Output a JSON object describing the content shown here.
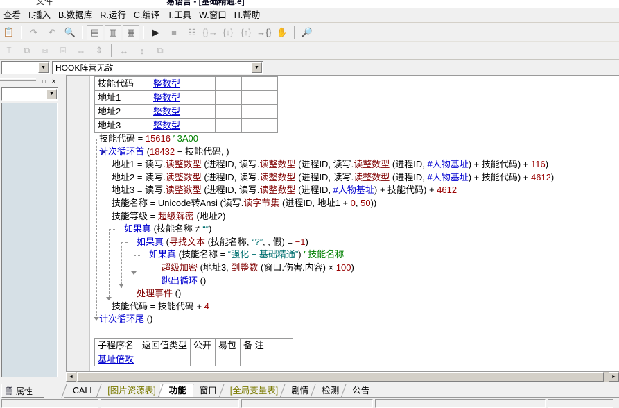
{
  "window": {
    "title_visible_fragment": "易语言 - [基础精通.e]",
    "left_title_fragment": "文件"
  },
  "menubar": {
    "items": [
      {
        "accel": "",
        "label": "查看"
      },
      {
        "accel": "I",
        "label": "插入"
      },
      {
        "accel": "B",
        "label": "数据库"
      },
      {
        "accel": "R",
        "label": "运行"
      },
      {
        "accel": "C",
        "label": "编译"
      },
      {
        "accel": "T",
        "label": "工具"
      },
      {
        "accel": "W",
        "label": "窗口"
      },
      {
        "accel": "H",
        "label": "帮助"
      }
    ]
  },
  "toolbar_main": {
    "buttons": [
      {
        "name": "paste-icon",
        "glyph": "📋",
        "state": "enabled"
      },
      {
        "name": "redo-icon",
        "glyph": "↷",
        "state": "disabled"
      },
      {
        "name": "undo-icon",
        "glyph": "↶",
        "state": "disabled"
      },
      {
        "name": "find-icon",
        "glyph": "🔍",
        "state": "enabled"
      },
      {
        "name": "layout-split-vertical-icon",
        "glyph": "▤",
        "state": "enabled"
      },
      {
        "name": "layout-split-horizontal-icon",
        "glyph": "▥",
        "state": "enabled"
      },
      {
        "name": "layout-grid-icon",
        "glyph": "▦",
        "state": "enabled"
      },
      {
        "name": "run-icon",
        "glyph": "▶",
        "state": "enabled"
      },
      {
        "name": "stop-icon",
        "glyph": "■",
        "state": "disabled"
      },
      {
        "name": "breakpoint-icon",
        "glyph": "☷",
        "state": "disabled"
      },
      {
        "name": "step-over-icon",
        "glyph": "{}→",
        "state": "disabled"
      },
      {
        "name": "step-into-icon",
        "glyph": "{↓}",
        "state": "disabled"
      },
      {
        "name": "step-out-icon",
        "glyph": "{↑}",
        "state": "disabled"
      },
      {
        "name": "run-to-cursor-icon",
        "glyph": "→{}",
        "state": "enabled"
      },
      {
        "name": "hand-pan-icon",
        "glyph": "✋",
        "state": "enabled"
      },
      {
        "name": "search-help-icon",
        "glyph": "🔎",
        "state": "enabled"
      }
    ]
  },
  "toolbar_align": {
    "buttons": [
      {
        "name": "align-left-icon",
        "glyph": "⌶"
      },
      {
        "name": "align-center-horizontal-icon",
        "glyph": "⧉"
      },
      {
        "name": "align-top-icon",
        "glyph": "⧈"
      },
      {
        "name": "align-bottom-icon",
        "glyph": "⌸"
      },
      {
        "name": "distribute-horizontal-icon",
        "glyph": "⇔"
      },
      {
        "name": "distribute-vertical-icon",
        "glyph": "⇕"
      },
      {
        "name": "same-width-icon",
        "glyph": "↔"
      },
      {
        "name": "same-height-icon",
        "glyph": "↕"
      },
      {
        "name": "same-size-icon",
        "glyph": "⧉"
      }
    ]
  },
  "combos": {
    "left_value": "",
    "main_value": "HOOK阵营无敌",
    "arrow_glyph": "▼"
  },
  "left_dock": {
    "maximize_glyph": "□",
    "close_glyph": "✕",
    "combo_value": "",
    "arrow_glyph": "▼"
  },
  "var_table": {
    "rows": [
      {
        "name": "技能代码",
        "type": "整数型",
        "c2": "",
        "c3": "",
        "c4": ""
      },
      {
        "name": "地址1",
        "type": "整数型",
        "c2": "",
        "c3": "",
        "c4": ""
      },
      {
        "name": "地址2",
        "type": "整数型",
        "c2": "",
        "c3": "",
        "c4": ""
      },
      {
        "name": "地址3",
        "type": "整数型",
        "c2": "",
        "c3": "",
        "c4": ""
      }
    ]
  },
  "sub_table": {
    "headers": [
      "子程序名",
      "返回值类型",
      "公开",
      "易包",
      "备 注"
    ],
    "rows": [
      {
        "name": "基址倍攻",
        "ret": "",
        "pub": "",
        "pkg": "",
        "note": ""
      }
    ]
  },
  "code": {
    "lines": [
      {
        "id": "line-1",
        "indent": 0,
        "segments": [
          {
            "t": "技能代码",
            "c": "var"
          },
          {
            "t": " = ",
            "c": "var"
          },
          {
            "t": "15616",
            "c": "num"
          },
          {
            "t": "   ′ 3A00",
            "c": "cmt"
          }
        ]
      },
      {
        "id": "line-2",
        "indent": 0,
        "segments": [
          {
            "t": "计次循环首",
            "c": "kw"
          },
          {
            "t": " (",
            "c": "var"
          },
          {
            "t": "18432",
            "c": "num"
          },
          {
            "t": " − ",
            "c": "var"
          },
          {
            "t": "技能代码",
            "c": "var"
          },
          {
            "t": ", )",
            "c": "var"
          }
        ]
      },
      {
        "id": "line-3",
        "indent": 1,
        "segments": [
          {
            "t": "地址1",
            "c": "var"
          },
          {
            "t": " = ",
            "c": "var"
          },
          {
            "t": "读写.",
            "c": "var"
          },
          {
            "t": "读整数型",
            "c": "cmd"
          },
          {
            "t": " (进程ID, 读写.",
            "c": "var"
          },
          {
            "t": "读整数型",
            "c": "cmd"
          },
          {
            "t": " (进程ID, 读写.",
            "c": "var"
          },
          {
            "t": "读整数型",
            "c": "cmd"
          },
          {
            "t": " (进程ID, ",
            "c": "var"
          },
          {
            "t": "#人物基址",
            "c": "blue"
          },
          {
            "t": ") + 技能代码) + ",
            "c": "var"
          },
          {
            "t": "116",
            "c": "num"
          },
          {
            "t": ")",
            "c": "var"
          }
        ]
      },
      {
        "id": "line-4",
        "indent": 1,
        "segments": [
          {
            "t": "地址2",
            "c": "var"
          },
          {
            "t": " = ",
            "c": "var"
          },
          {
            "t": "读写.",
            "c": "var"
          },
          {
            "t": "读整数型",
            "c": "cmd"
          },
          {
            "t": " (进程ID, 读写.",
            "c": "var"
          },
          {
            "t": "读整数型",
            "c": "cmd"
          },
          {
            "t": " (进程ID, 读写.",
            "c": "var"
          },
          {
            "t": "读整数型",
            "c": "cmd"
          },
          {
            "t": " (进程ID, ",
            "c": "var"
          },
          {
            "t": "#人物基址",
            "c": "blue"
          },
          {
            "t": ") + 技能代码) + ",
            "c": "var"
          },
          {
            "t": "4612",
            "c": "num"
          },
          {
            "t": ")",
            "c": "var"
          }
        ]
      },
      {
        "id": "line-5",
        "indent": 1,
        "segments": [
          {
            "t": "地址3",
            "c": "var"
          },
          {
            "t": " = ",
            "c": "var"
          },
          {
            "t": "读写.",
            "c": "var"
          },
          {
            "t": "读整数型",
            "c": "cmd"
          },
          {
            "t": " (进程ID, 读写.",
            "c": "var"
          },
          {
            "t": "读整数型",
            "c": "cmd"
          },
          {
            "t": " (进程ID, ",
            "c": "var"
          },
          {
            "t": "#人物基址",
            "c": "blue"
          },
          {
            "t": ") + 技能代码) + ",
            "c": "var"
          },
          {
            "t": "4612",
            "c": "num"
          }
        ]
      },
      {
        "id": "line-6",
        "indent": 1,
        "segments": [
          {
            "t": "技能名称",
            "c": "var"
          },
          {
            "t": " = ",
            "c": "var"
          },
          {
            "t": "Unicode转Ansi",
            "c": "var"
          },
          {
            "t": " (读写.",
            "c": "var"
          },
          {
            "t": "读字节集",
            "c": "cmd"
          },
          {
            "t": " (进程ID, 地址1 + ",
            "c": "var"
          },
          {
            "t": "0",
            "c": "num"
          },
          {
            "t": ", ",
            "c": "var"
          },
          {
            "t": "50",
            "c": "num"
          },
          {
            "t": "))",
            "c": "var"
          }
        ]
      },
      {
        "id": "line-7",
        "indent": 1,
        "segments": [
          {
            "t": "技能等级",
            "c": "var"
          },
          {
            "t": " = ",
            "c": "var"
          },
          {
            "t": "超级解密",
            "c": "cmd"
          },
          {
            "t": " (地址2)",
            "c": "var"
          }
        ]
      },
      {
        "id": "line-8",
        "indent": 2,
        "segments": [
          {
            "t": "如果真",
            "c": "kw"
          },
          {
            "t": " (技能名称 ≠ ",
            "c": "var"
          },
          {
            "t": "“”",
            "c": "str"
          },
          {
            "t": ")",
            "c": "var"
          }
        ]
      },
      {
        "id": "line-9",
        "indent": 3,
        "segments": [
          {
            "t": "如果真",
            "c": "kw"
          },
          {
            "t": " (",
            "c": "var"
          },
          {
            "t": "寻找文本",
            "c": "cmd"
          },
          {
            "t": " (技能名称, ",
            "c": "var"
          },
          {
            "t": "“?”",
            "c": "str"
          },
          {
            "t": ", , 假) = ",
            "c": "var"
          },
          {
            "t": "−1",
            "c": "num"
          },
          {
            "t": ")",
            "c": "var"
          }
        ]
      },
      {
        "id": "line-10",
        "indent": 4,
        "segments": [
          {
            "t": "如果真",
            "c": "kw"
          },
          {
            "t": " (技能名称 = ",
            "c": "var"
          },
          {
            "t": "“强化 − 基础精通”",
            "c": "str"
          },
          {
            "t": ")",
            "c": "var"
          },
          {
            "t": "  ′ 技能名称",
            "c": "cmt"
          }
        ]
      },
      {
        "id": "line-11",
        "indent": 5,
        "segments": [
          {
            "t": "超级加密",
            "c": "cmd"
          },
          {
            "t": " (地址3, ",
            "c": "var"
          },
          {
            "t": "到整数",
            "c": "cmd"
          },
          {
            "t": " (窗口.伤害.内容) × ",
            "c": "var"
          },
          {
            "t": "100",
            "c": "num"
          },
          {
            "t": ")",
            "c": "var"
          }
        ]
      },
      {
        "id": "line-12",
        "indent": 5,
        "segments": [
          {
            "t": "跳出循环",
            "c": "kw"
          },
          {
            "t": " ()",
            "c": "var"
          }
        ]
      },
      {
        "id": "line-13",
        "indent": 3,
        "segments": [
          {
            "t": "处理事件",
            "c": "cmd"
          },
          {
            "t": " ()",
            "c": "var"
          }
        ]
      },
      {
        "id": "line-14",
        "indent": 1,
        "segments": [
          {
            "t": "技能代码",
            "c": "var"
          },
          {
            "t": " = 技能代码 + ",
            "c": "var"
          },
          {
            "t": "4",
            "c": "num"
          }
        ]
      },
      {
        "id": "line-15",
        "indent": 0,
        "segments": [
          {
            "t": "计次循环尾",
            "c": "kw"
          },
          {
            "t": " ()",
            "c": "var"
          }
        ]
      }
    ]
  },
  "scrollbar": {
    "left_arrow": "◄",
    "right_arrow": "►"
  },
  "property_tab": {
    "label": "属性",
    "icon": "🗒"
  },
  "tabbar": {
    "tabs": [
      {
        "label": "CALL",
        "style": "normal"
      },
      {
        "label": "[图片资源表]",
        "style": "olive"
      },
      {
        "label": "功能",
        "style": "active"
      },
      {
        "label": "窗口",
        "style": "normal"
      },
      {
        "label": "[全局变量表]",
        "style": "olive"
      },
      {
        "label": "剧情",
        "style": "normal"
      },
      {
        "label": "检测",
        "style": "normal"
      },
      {
        "label": "公告",
        "style": "normal"
      }
    ]
  },
  "colors": {
    "keyword_blue": "#0000d0",
    "command_darkred": "#800000",
    "number_red": "#990000",
    "string_teal": "#007070",
    "comment_green": "#008000",
    "window_gray": "#f0f0f0",
    "panel_blue": "#d6e0e6",
    "olive_tab": "#7a7a00"
  }
}
